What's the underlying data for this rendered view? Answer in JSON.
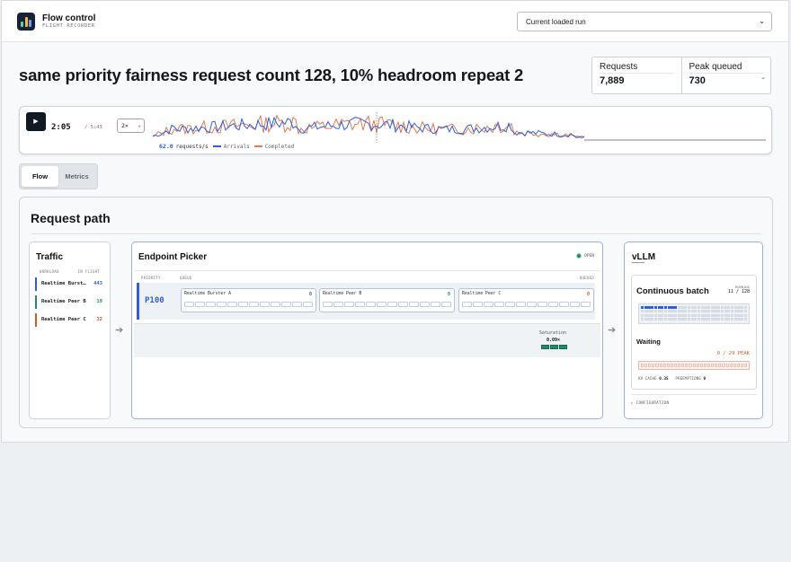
{
  "brand": {
    "title": "Flow control",
    "subtitle": "FLIGHT RECORDER"
  },
  "run_select": {
    "value": "Current loaded run"
  },
  "page": {
    "title": "same priority fairness request count 128, 10% headroom repeat 2"
  },
  "stats": [
    {
      "label": "Requests",
      "value": "7,889"
    },
    {
      "label": "Peak queued",
      "value": "730"
    }
  ],
  "timeline": {
    "current": "2:05",
    "total": "/ 5:43",
    "speed": "2×",
    "rate_value": "62.0",
    "rate_unit": "requests/s",
    "legend": [
      {
        "name": "Arrivals",
        "color": "#2f5fe0"
      },
      {
        "name": "Completed",
        "color": "#e07a52"
      }
    ]
  },
  "tabs": [
    {
      "label": "Flow",
      "active": true
    },
    {
      "label": "Metrics",
      "active": false
    }
  ],
  "request_path": {
    "title": "Request path",
    "traffic": {
      "title": "Traffic",
      "col_workload": "WORKLOAD",
      "col_inflight": "IN FLIGHT",
      "items": [
        {
          "name": "Realtime Burst…",
          "count": "443",
          "color": "#2f5fe0"
        },
        {
          "name": "Realtime Peer B",
          "count": "19",
          "color": "#1c8c69"
        },
        {
          "name": "Realtime Peer C",
          "count": "32",
          "color": "#cf5a2c"
        }
      ]
    },
    "picker": {
      "title": "Endpoint Picker",
      "status": "OPEN",
      "col_priority": "PRIORITY",
      "col_queue": "QUEUE",
      "col_queued": "QUEUED",
      "priority": "P100",
      "queues": [
        {
          "name": "Realtime Burster A",
          "count": "0",
          "color": "#2f5fe0"
        },
        {
          "name": "Realtime Peer B",
          "count": "0",
          "color": "#1c8c69"
        },
        {
          "name": "Realtime Peer C",
          "count": "0",
          "color": "#cf5a2c"
        }
      ],
      "saturation_label": "Saturation",
      "saturation_value": "0.09×"
    },
    "vllm": {
      "title": "vLLM",
      "batch_title": "Continuous batch",
      "running_label": "RUNNING",
      "running_value": "11 / 128",
      "running_fraction": 0.086,
      "waiting_title": "Waiting",
      "waiting_value": "0 / 29 PEAK",
      "kv_cache_label": "KV CACHE",
      "kv_cache_value": "0.35",
      "preemptions_label": "PREEMPTIONS",
      "preemptions_value": "0",
      "config_label": "▸ CONFIGURATION"
    }
  }
}
